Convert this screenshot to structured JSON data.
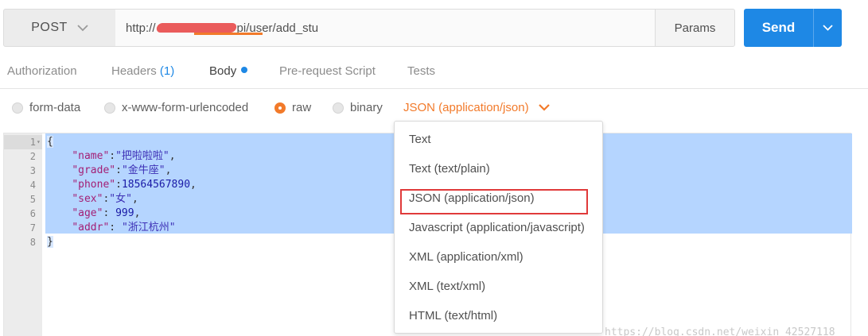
{
  "request": {
    "method": "POST",
    "url_prefix": "http://",
    "url_suffix": "pi/user/add_stu",
    "params_label": "Params",
    "send_label": "Send"
  },
  "tabs": {
    "authorization": "Authorization",
    "headers": "Headers",
    "headers_count": "(1)",
    "body": "Body",
    "prerequest": "Pre-request Script",
    "tests": "Tests"
  },
  "body_types": {
    "form_data": "form-data",
    "urlencoded": "x-www-form-urlencoded",
    "raw": "raw",
    "binary": "binary",
    "selected": "raw"
  },
  "content_type": {
    "selected": "JSON (application/json)",
    "options": [
      "Text",
      "Text (text/plain)",
      "JSON (application/json)",
      "Javascript (application/javascript)",
      "XML (application/xml)",
      "XML (text/xml)",
      "HTML (text/html)"
    ]
  },
  "editor": {
    "line_numbers": [
      "1",
      "2",
      "3",
      "4",
      "5",
      "6",
      "7",
      "8"
    ],
    "lines": [
      [
        {
          "t": "{",
          "c": "br"
        }
      ],
      [
        {
          "t": "    ",
          "c": "p"
        },
        {
          "t": "\"name\"",
          "c": "k"
        },
        {
          "t": ":",
          "c": "p"
        },
        {
          "t": "\"把啦啦啦\"",
          "c": "s"
        },
        {
          "t": ",",
          "c": "p"
        }
      ],
      [
        {
          "t": "    ",
          "c": "p"
        },
        {
          "t": "\"grade\"",
          "c": "k"
        },
        {
          "t": ":",
          "c": "p"
        },
        {
          "t": "\"金牛座\"",
          "c": "s"
        },
        {
          "t": ",",
          "c": "p"
        }
      ],
      [
        {
          "t": "    ",
          "c": "p"
        },
        {
          "t": "\"phone\"",
          "c": "k"
        },
        {
          "t": ":",
          "c": "p"
        },
        {
          "t": "18564567890",
          "c": "n"
        },
        {
          "t": ",",
          "c": "p"
        }
      ],
      [
        {
          "t": "    ",
          "c": "p"
        },
        {
          "t": "\"sex\"",
          "c": "k"
        },
        {
          "t": ":",
          "c": "p"
        },
        {
          "t": "\"女\"",
          "c": "s"
        },
        {
          "t": ",",
          "c": "p"
        }
      ],
      [
        {
          "t": "    ",
          "c": "p"
        },
        {
          "t": "\"age\"",
          "c": "k"
        },
        {
          "t": ": ",
          "c": "p"
        },
        {
          "t": "999",
          "c": "n"
        },
        {
          "t": ",",
          "c": "p"
        }
      ],
      [
        {
          "t": "    ",
          "c": "p"
        },
        {
          "t": "\"addr\"",
          "c": "k"
        },
        {
          "t": ": ",
          "c": "p"
        },
        {
          "t": "\"浙江杭州\"",
          "c": "s"
        }
      ],
      [
        {
          "t": "}",
          "c": "br"
        }
      ]
    ]
  },
  "watermark": "https://blog.csdn.net/weixin_42527118",
  "colors": {
    "accent": "#f27a2a",
    "send": "#1e88e5",
    "selection": "#b5d5ff",
    "highlight_box": "#e03a3a"
  },
  "icons": {
    "method_dropdown": "chevron-down-icon",
    "send_dropdown": "chevron-down-icon",
    "content_type_dropdown": "chevron-down-icon",
    "body_tab_indicator": "dot-icon"
  }
}
